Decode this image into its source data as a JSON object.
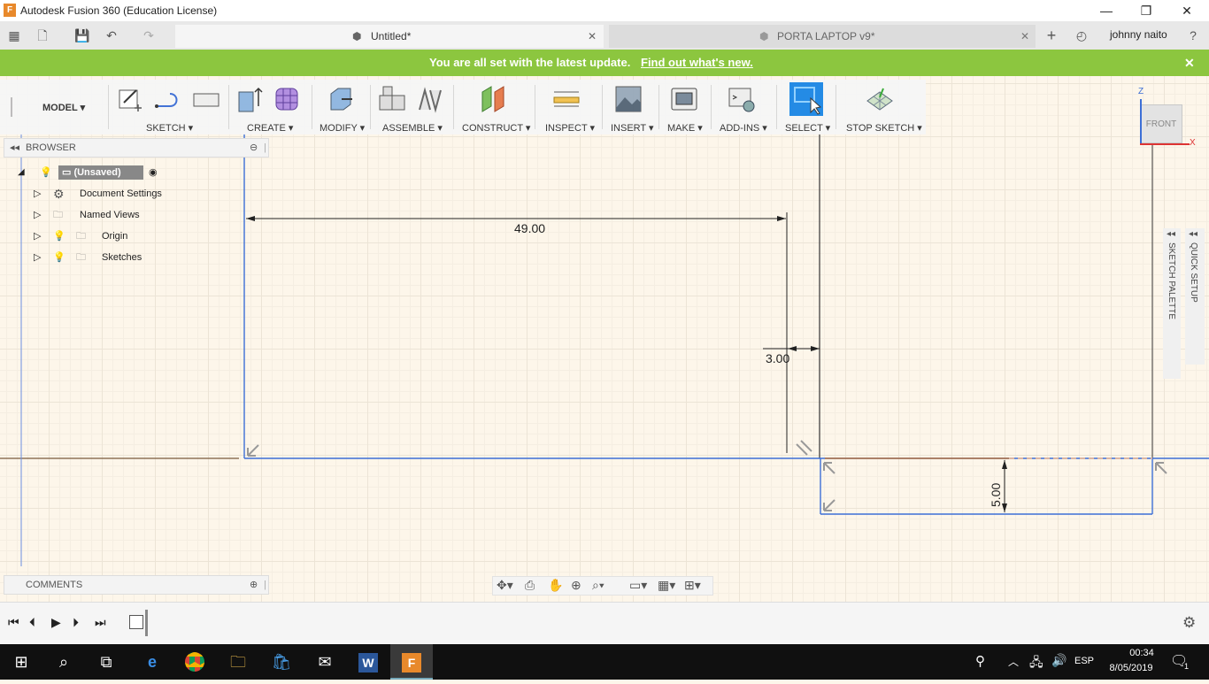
{
  "window": {
    "title": "Autodesk Fusion 360 (Education License)",
    "app_icon_letter": "F",
    "minimize": "—",
    "restore": "❐",
    "close": "✕"
  },
  "tabs": [
    {
      "label": "Untitled*"
    },
    {
      "label": "PORTA LAPTOP v9*"
    }
  ],
  "user": {
    "name": "johnny naito"
  },
  "banner": {
    "text": "You are all set with the latest update.",
    "link": "Find out what's new.",
    "close": "✕"
  },
  "toolbar": {
    "workspace": "MODEL",
    "groups": [
      "SKETCH",
      "CREATE",
      "MODIFY",
      "ASSEMBLE",
      "CONSTRUCT",
      "INSPECT",
      "INSERT",
      "MAKE",
      "ADD-INS",
      "SELECT",
      "STOP SKETCH"
    ]
  },
  "browser": {
    "title": "BROWSER",
    "root": "(Unsaved)",
    "items": [
      "Document Settings",
      "Named Views",
      "Origin",
      "Sketches"
    ]
  },
  "viewcube": {
    "face": "FRONT",
    "axis_z": "Z",
    "axis_x": "X"
  },
  "sketch": {
    "dim_width": "49.00",
    "dim_gap": "3.00",
    "dim_height": "5.00"
  },
  "side_panels": {
    "sketch_palette": "SKETCH PALETTE",
    "quick_setup": "QUICK SETUP"
  },
  "comments": {
    "title": "COMMENTS"
  },
  "taskbar": {
    "lang": "ESP",
    "time": "00:34",
    "date": "8/05/2019",
    "notif_count": "1"
  },
  "colors": {
    "banner": "#8cc63f",
    "select_active": "#1e88e5",
    "sketch_line": "#3d6fd6",
    "taskbar": "#101010"
  }
}
